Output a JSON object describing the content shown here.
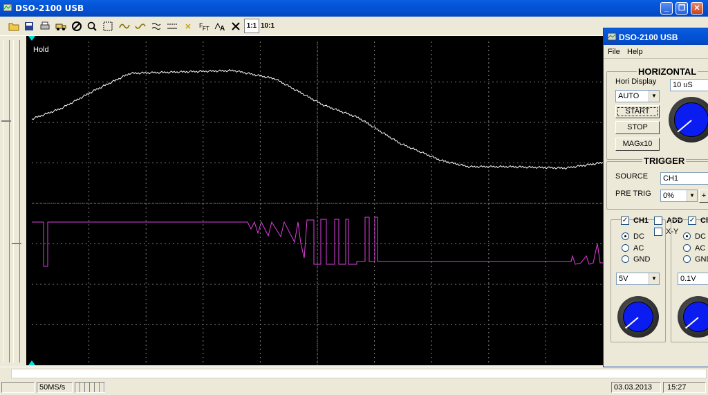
{
  "window": {
    "title": "DSO-2100 USB",
    "minimize": "_",
    "maximize": "❐",
    "close": "✕"
  },
  "toolbar": {
    "buttons": [
      "open-icon",
      "save-icon",
      "print-icon",
      "truck-icon",
      "stop-icon",
      "zoom-icon",
      "cursor-box-icon",
      "sine-icon",
      "sine-icon",
      "math-icon",
      "dashes-icon",
      "x-icon",
      "fft-icon",
      "autoset-icon",
      "cross-icon"
    ],
    "ratio_1": "1:1",
    "ratio_10": "10:1"
  },
  "screen": {
    "hold_label": "Hold",
    "ch1_color": "#ffffff",
    "ch2_color": "#e040e0",
    "marker_color": "#00e0e0"
  },
  "panel": {
    "title": "DSO-2100 USB",
    "menu": {
      "file": "File",
      "help": "Help"
    },
    "horizontal": {
      "title": "HORIZONTAL",
      "hori_display_label": "Hori Display",
      "timebase": "10 uS",
      "mode": "AUTO",
      "start": "START",
      "stop": "STOP",
      "mag": "MAGx10"
    },
    "trigger": {
      "title": "TRIGGER",
      "source_label": "SOURCE",
      "source": "CH1",
      "pretrig_label": "PRE TRIG",
      "pretrig": "0%",
      "plus": "+"
    },
    "ch1": {
      "label": "CH1",
      "dc": "DC",
      "ac": "AC",
      "gnd": "GND",
      "volts": "5V"
    },
    "add": {
      "label": "ADD",
      "xy": "X-Y"
    },
    "ch2": {
      "label": "Cl",
      "dc": "DC",
      "ac": "AC",
      "gnd": "GND",
      "volts": "0.1V"
    }
  },
  "status": {
    "rate": "50MS/s",
    "date": "03.03.2013",
    "time": "15:27"
  }
}
